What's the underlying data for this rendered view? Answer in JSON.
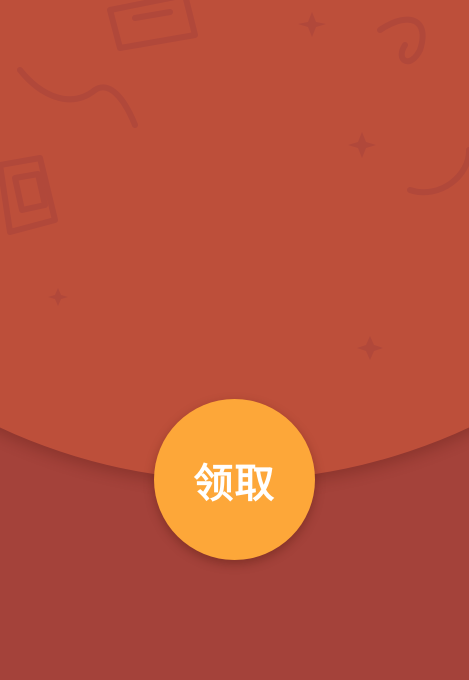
{
  "envelope": {
    "open_button": {
      "label": "领取"
    },
    "colors": {
      "flap": "#bd4f3a",
      "lower_panel": "#a4423a",
      "button": "#fda739",
      "button_text": "#ffffff",
      "pattern": "#b1483a"
    },
    "decorations": [
      "ingot-icon",
      "ribbon-icon",
      "sparkle-icon"
    ]
  }
}
